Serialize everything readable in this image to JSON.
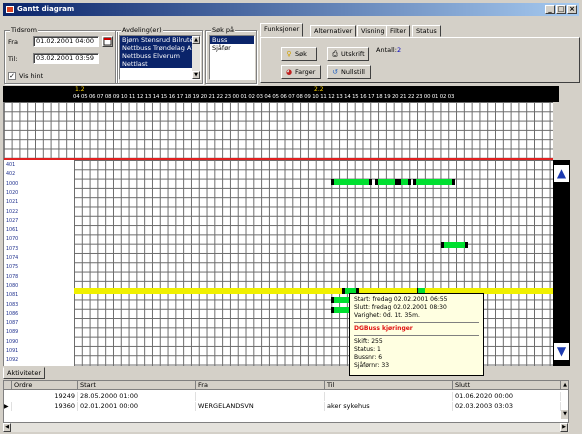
{
  "window": {
    "title": "Gantt diagram",
    "min": "_",
    "max": "□",
    "close": "×"
  },
  "tidsrom": {
    "label": "Tidsrom",
    "fra_label": "Fra",
    "fra_value": "01.02.2001 04:00",
    "til_label": "Til:",
    "til_value": "03.02.2001 03:59",
    "vis_hint": "Vis hint",
    "vis_hint_checked": true
  },
  "avdeling": {
    "label": "Avdeling(er)",
    "items": [
      "Bjørn Stensrud Bilruter",
      "Nettbuss Trøndelag AS",
      "Nettbuss Elverum",
      "Nettlast"
    ]
  },
  "sok_pa": {
    "label": "Søk på",
    "items": [
      "Buss",
      "Sjåfør"
    ]
  },
  "tabs": [
    "Funksjoner",
    "Alternativer",
    "Visning",
    "Filter",
    "Status"
  ],
  "buttons": {
    "sok": "Søk",
    "utskrift": "Utskrift",
    "farger": "Farger",
    "nullstill": "Nullstill"
  },
  "antall": {
    "label": "Antall:",
    "value": "2"
  },
  "timeline": {
    "day1": "1.2",
    "day2": "2.2",
    "hours": "04 05 06 07 08 09 10 11 12 13 14 15 16 17 18 19 20 21 22 23 00 01 02 03 04 05 06 07 08 09 10 11 12 13 14 15 16 17 18 19 20 21 22 23 00 01 02 03"
  },
  "rows": [
    "401",
    "402",
    "1000",
    "1020",
    "1021",
    "1022",
    "1027",
    "1061",
    "1070",
    "1073",
    "1074",
    "1075",
    "1078",
    "1080",
    "1081",
    "1083",
    "1086",
    "1087",
    "1089",
    "1090",
    "1091",
    "1092"
  ],
  "tooltip": {
    "start": "Start: fredag 02.02.2001 06:55",
    "slutt": "Slutt: fredag 02.02.2001 08:30",
    "varighet": "Varighet: 0d. 1t. 35m.",
    "title": "DGBuss kjøringer",
    "skift": "Skift: 255",
    "status": "Status: 1",
    "bussnr": "Bussnr: 6",
    "sjafornr": "Sjåførnr: 33"
  },
  "bottom_tab": "Aktiviteter",
  "table": {
    "columns": [
      "Ordre",
      "Start",
      "Fra",
      "Til",
      "Slutt"
    ],
    "rows": [
      [
        "19249",
        "28.05.2000 01:00",
        "",
        "",
        "01.06.2020 00:00"
      ],
      [
        "19360",
        "02.01.2001 00:00",
        "WERGELANDSVN",
        "aker sykehus",
        "02.03.2003 03:03"
      ]
    ]
  },
  "colors": {
    "title_bar": "#0a246a",
    "bar": "#00e030",
    "highlight_row": "#f0f000",
    "divider": "#e02020",
    "selection": "#0a246a"
  }
}
